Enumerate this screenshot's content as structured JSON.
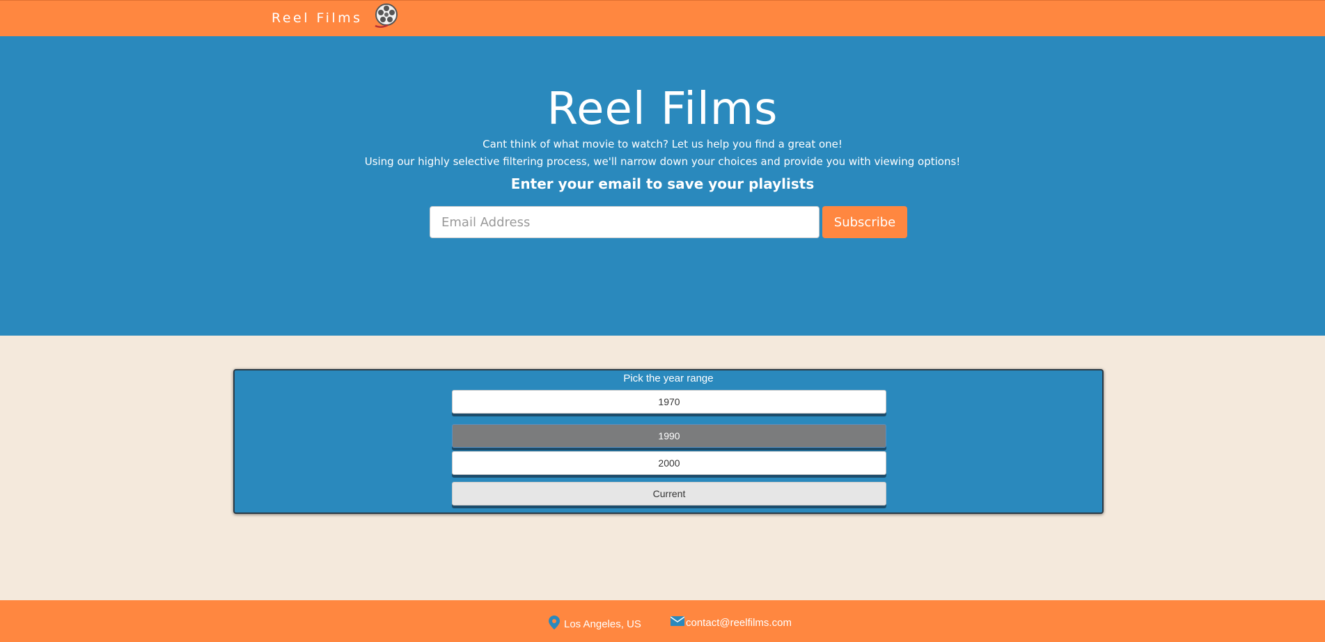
{
  "navbar": {
    "brand": "Reel Films",
    "icon": "film-reel-icon"
  },
  "hero": {
    "title": "Reel Films",
    "line1": "Cant think of what movie to watch? Let us help you find a great one!",
    "line2": "Using our highly selective filtering process, we'll narrow down your choices and provide you with viewing options!",
    "cta": "Enter your email to save your playlists",
    "email_placeholder": "Email Address",
    "subscribe_label": "Subscribe"
  },
  "year_range": {
    "label": "Pick the year range",
    "options": [
      "1970",
      "1990",
      "2000",
      "Current"
    ],
    "selected": "1990"
  },
  "footer": {
    "location": "Los Angeles, US",
    "location_icon": "map-pin-icon",
    "email": "contact@reelfilms.com",
    "email_icon": "envelope-icon"
  },
  "colors": {
    "accent_orange": "#ff8740",
    "hero_blue": "#2a89bd",
    "background_beige": "#f4e9dc",
    "selected_gray": "#7b7c7d"
  }
}
